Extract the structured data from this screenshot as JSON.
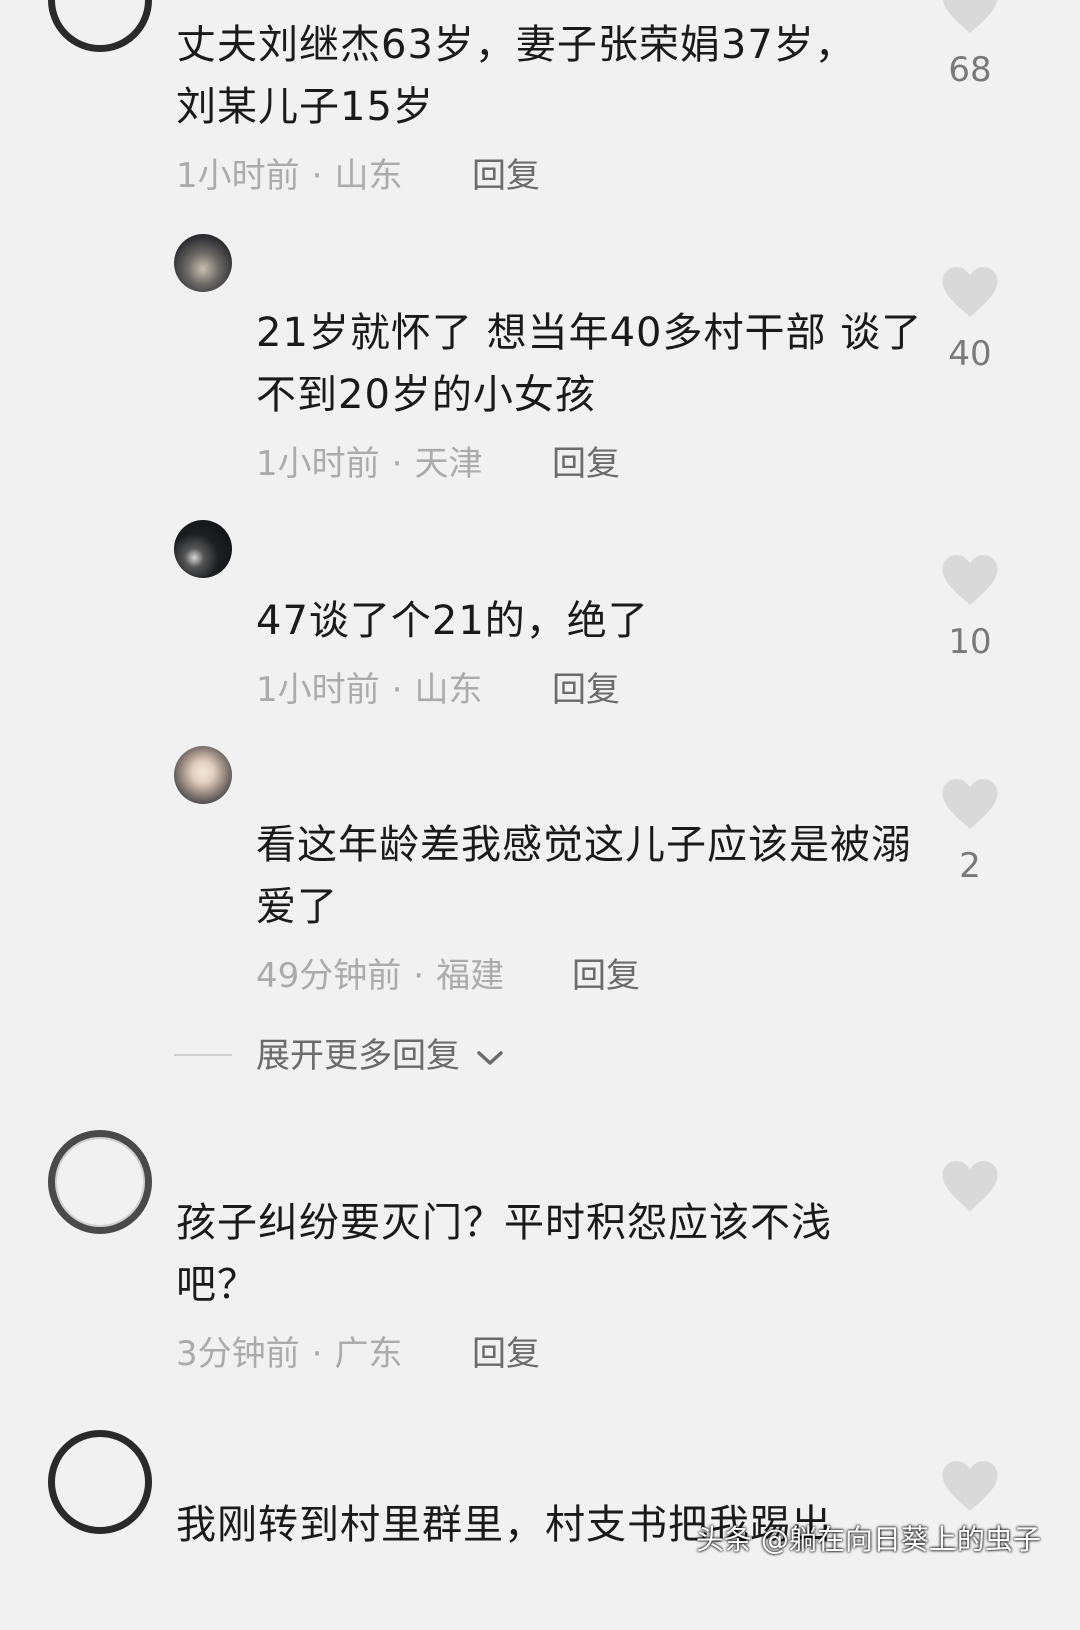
{
  "comments": [
    {
      "text": "丈夫刘继杰63岁，妻子张荣娟37岁，刘某儿子15岁",
      "time": "1小时前",
      "location": "山东",
      "reply_label": "回复",
      "likes": "68"
    },
    {
      "text": "21岁就怀了  想当年40多村干部  谈了不到20岁的小女孩",
      "time": "1小时前",
      "location": "天津",
      "reply_label": "回复",
      "likes": "40"
    },
    {
      "text": "47谈了个21的，绝了",
      "time": "1小时前",
      "location": "山东",
      "reply_label": "回复",
      "likes": "10"
    },
    {
      "text": "看这年龄差我感觉这儿子应该是被溺爱了",
      "time": "49分钟前",
      "location": "福建",
      "reply_label": "回复",
      "likes": "2"
    },
    {
      "text": "孩子纠纷要灭门？平时积怨应该不浅吧？",
      "time": "3分钟前",
      "location": "广东",
      "reply_label": "回复",
      "likes": ""
    },
    {
      "text": "我刚转到村里群里，村支书把我踢出",
      "time": "",
      "location": "",
      "reply_label": "",
      "likes": ""
    }
  ],
  "expand_label": "展开更多回复",
  "watermark": "头条 @躺在向日葵上的虫子",
  "colors": {
    "background": "#f1f1f1",
    "text": "#1a1a1a",
    "meta": "#ababab",
    "heart": "#d9d9d9"
  }
}
